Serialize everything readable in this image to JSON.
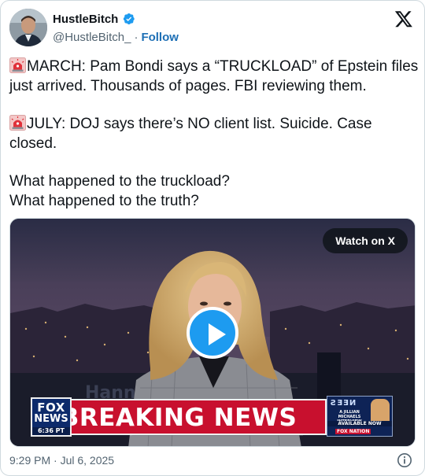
{
  "author": {
    "display_name": "HustleBitch",
    "handle": "@HustleBitch_",
    "separator": "·",
    "follow_label": "Follow",
    "verified": true
  },
  "tweet": {
    "paragraphs": [
      {
        "emoji": "siren-icon",
        "text": "MARCH: Pam Bondi says a “TRUCKLOAD” of Epstein files just arrived. Thousands of pages. FBI reviewing them."
      },
      {
        "emoji": "siren-icon",
        "text": "JULY: DOJ says there’s NO client list. Suicide. Case closed."
      },
      {
        "emoji": null,
        "lines": [
          "What happened to the truckload?",
          "What happened to the truth?"
        ]
      }
    ]
  },
  "media": {
    "watch_label": "Watch on X",
    "ticker_text": "BREAKING NEWS",
    "network_logo": [
      "FOX",
      "NEWS"
    ],
    "time": "6:36 PT",
    "promo": {
      "title": "ƧƎƎИ",
      "guest": "A JILLIAN MICHAELS INTERVIEW",
      "availability": "AVAILABLE NOW",
      "brand": "FOX NATION"
    },
    "background_watermark": "Hann"
  },
  "footer": {
    "timestamp": "9:29 PM · Jul 6, 2025"
  },
  "colors": {
    "follow": "#1d6fb5",
    "verified": "#1d9bf0",
    "ticker": "#c8102e",
    "secondary_text": "#536471"
  }
}
